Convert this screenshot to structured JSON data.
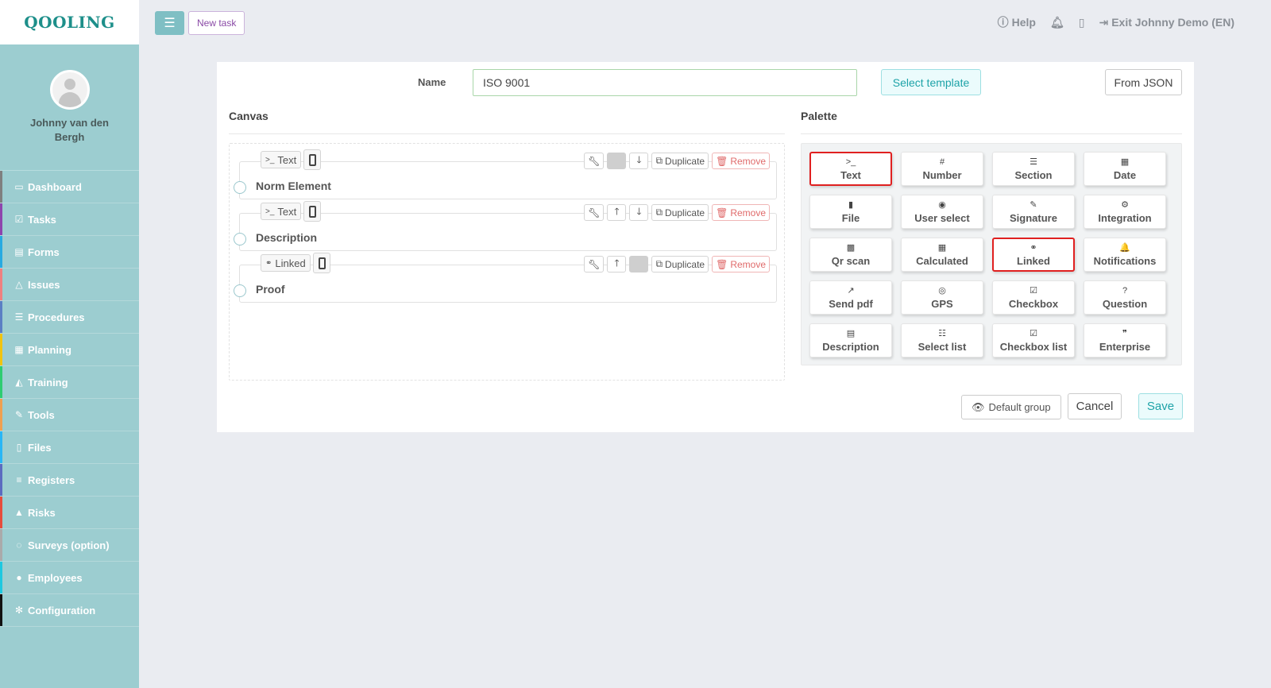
{
  "app": {
    "logo": "QOOLING"
  },
  "user": {
    "name": "Johnny van den Bergh"
  },
  "sidebar": {
    "items": [
      {
        "label": "Dashboard",
        "icon": "desktop-icon",
        "glyph": "▭",
        "color": "#7f7f7f"
      },
      {
        "label": "Tasks",
        "icon": "check-square-icon",
        "glyph": "☑",
        "color": "#8e44ad"
      },
      {
        "label": "Forms",
        "icon": "form-icon",
        "glyph": "▤",
        "color": "#27aae1"
      },
      {
        "label": "Issues",
        "icon": "bell-icon",
        "glyph": "△",
        "color": "#f08080"
      },
      {
        "label": "Procedures",
        "icon": "list-icon",
        "glyph": "☰",
        "color": "#5b7fc4"
      },
      {
        "label": "Planning",
        "icon": "calendar-icon",
        "glyph": "▦",
        "color": "#f1c40f"
      },
      {
        "label": "Training",
        "icon": "graduation-cap-icon",
        "glyph": "◭",
        "color": "#2ecc71"
      },
      {
        "label": "Tools",
        "icon": "wrench-icon",
        "glyph": "✎",
        "color": "#f0a050"
      },
      {
        "label": "Files",
        "icon": "file-icon",
        "glyph": "▯",
        "color": "#29b6f6"
      },
      {
        "label": "Registers",
        "icon": "bars-icon",
        "glyph": "≡",
        "color": "#5c6bc0"
      },
      {
        "label": "Risks",
        "icon": "warning-icon",
        "glyph": "▲",
        "color": "#e74c3c"
      },
      {
        "label": "Surveys (option)",
        "icon": "comment-icon",
        "glyph": "◌",
        "color": "#aaaaaa"
      },
      {
        "label": "Employees",
        "icon": "users-icon",
        "glyph": "●",
        "color": "#1ec8e0"
      },
      {
        "label": "Configuration",
        "icon": "gear-icon",
        "glyph": "✻",
        "color": "#111111"
      }
    ]
  },
  "topbar": {
    "new_task": "New task",
    "help": "Help",
    "exit": "Exit Johnny Demo (EN)"
  },
  "form": {
    "name_label": "Name",
    "name_value": "ISO 9001",
    "select_template": "Select template",
    "from_json": "From JSON"
  },
  "canvas": {
    "title": "Canvas",
    "fields": [
      {
        "type": "Text",
        "type_glyph": ">_",
        "label": "Norm Element"
      },
      {
        "type": "Text",
        "type_glyph": ">_",
        "label": "Description"
      },
      {
        "type": "Linked",
        "type_glyph": "⚭",
        "label": "Proof"
      }
    ],
    "duplicate": "Duplicate",
    "remove": "Remove"
  },
  "palette": {
    "title": "Palette",
    "items": [
      {
        "label": "Text",
        "glyph": ">_",
        "icon": "terminal-icon",
        "highlight": true
      },
      {
        "label": "Number",
        "glyph": "#",
        "icon": "hash-icon",
        "highlight": false
      },
      {
        "label": "Section",
        "glyph": "☰",
        "icon": "section-icon",
        "highlight": false
      },
      {
        "label": "Date",
        "glyph": "▦",
        "icon": "calendar-icon",
        "highlight": false
      },
      {
        "label": "File",
        "glyph": "▮",
        "icon": "file-icon",
        "highlight": false
      },
      {
        "label": "User select",
        "glyph": "◉",
        "icon": "user-circle-icon",
        "highlight": false
      },
      {
        "label": "Signature",
        "glyph": "✎",
        "icon": "signature-icon",
        "highlight": false
      },
      {
        "label": "Integration",
        "glyph": "⚙",
        "icon": "cogs-icon",
        "highlight": false
      },
      {
        "label": "Qr scan",
        "glyph": "▩",
        "icon": "qrcode-icon",
        "highlight": false
      },
      {
        "label": "Calculated",
        "glyph": "▦",
        "icon": "calculator-icon",
        "highlight": false
      },
      {
        "label": "Linked",
        "glyph": "⚭",
        "icon": "link-icon",
        "highlight": true
      },
      {
        "label": "Notifications",
        "glyph": "🔔",
        "icon": "bell-icon",
        "highlight": false
      },
      {
        "label": "Send pdf",
        "glyph": "↗",
        "icon": "share-icon",
        "highlight": false
      },
      {
        "label": "GPS",
        "glyph": "◎",
        "icon": "compass-icon",
        "highlight": false
      },
      {
        "label": "Checkbox",
        "glyph": "☑",
        "icon": "check-square-icon",
        "highlight": false
      },
      {
        "label": "Question",
        "glyph": "?",
        "icon": "question-circle-icon",
        "highlight": false
      },
      {
        "label": "Description",
        "glyph": "▤",
        "icon": "file-text-icon",
        "highlight": false
      },
      {
        "label": "Select list",
        "glyph": "☷",
        "icon": "list-ol-icon",
        "highlight": false
      },
      {
        "label": "Checkbox list",
        "glyph": "☑",
        "icon": "check-square-icon",
        "highlight": false
      },
      {
        "label": "Enterprise",
        "glyph": "❞",
        "icon": "quote-icon",
        "highlight": false
      }
    ]
  },
  "footer": {
    "default_group": "Default group",
    "cancel": "Cancel",
    "save": "Save"
  }
}
